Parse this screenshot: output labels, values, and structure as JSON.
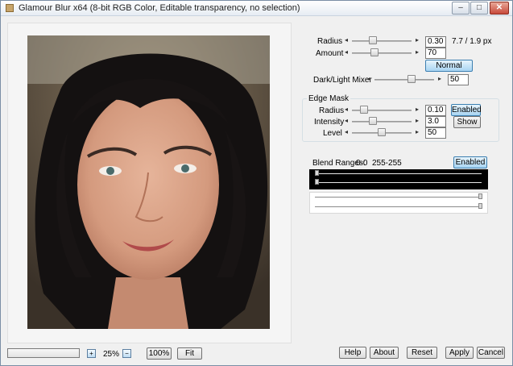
{
  "window": {
    "title": "Glamour Blur x64 (8-bit RGB Color, Editable transparency, no selection)",
    "minimize": "–",
    "maximize": "□",
    "close": "✕"
  },
  "controls": {
    "radius": {
      "label": "Radius",
      "value": "0.30",
      "readout": "7.7 / 1.9 px",
      "slider_fraction": 0.33
    },
    "amount": {
      "label": "Amount",
      "value": "70",
      "slider_fraction": 0.36
    },
    "mode_button": "Normal",
    "dark_light": {
      "label": "Dark/Light Mixer",
      "value": "50",
      "slider_fraction": 0.64
    },
    "edge_mask": {
      "title": "Edge Mask",
      "radius": {
        "label": "Radius",
        "value": "0.10",
        "slider_fraction": 0.15
      },
      "intensity": {
        "label": "Intensity",
        "value": "3.0",
        "slider_fraction": 0.33
      },
      "level": {
        "label": "Level",
        "value": "50",
        "slider_fraction": 0.5
      },
      "enabled_button": "Enabled",
      "show_button": "Show"
    },
    "blend": {
      "label": "Blend Ranges:",
      "range_low": "0-0",
      "range_high": "255-255",
      "enabled_button": "Enabled"
    }
  },
  "bottom": {
    "zoom_percent": "25%",
    "zoom_100": "100%",
    "fit": "Fit",
    "help": "Help",
    "about": "About",
    "reset": "Reset",
    "apply": "Apply",
    "cancel": "Cancel"
  },
  "colors": {
    "accent_button": "#a8d4f2",
    "window_bg": "#f0f0f0",
    "blend_dark": "#000000"
  },
  "icons": {
    "app": "app-icon",
    "zoom_in": "zoom-in-icon",
    "zoom_out": "zoom-out-icon"
  }
}
